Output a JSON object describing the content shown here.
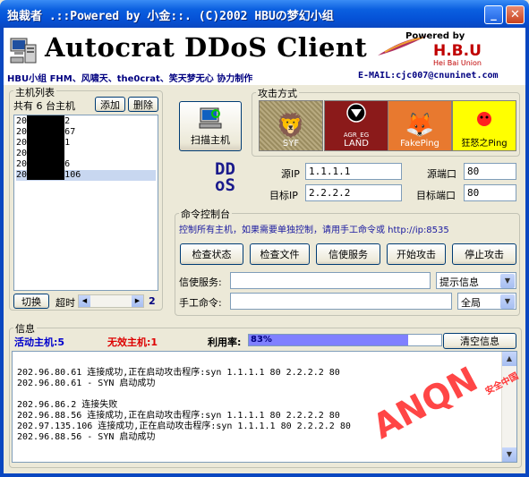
{
  "window": {
    "title": "独裁者 .::Powered by 小金::. (C)2002 HBUの梦幻小组",
    "minimize_label": "_",
    "close_label": "✕"
  },
  "banner": {
    "title": "Autocrat DDoS Client",
    "credits": "HBU小组 FHM、风啸天、the0crat、笑天梦无心 协力制作",
    "email": "E-MAIL:cjc007@cnuninet.com",
    "powered_by": "Powered by",
    "brand": "H.B.U",
    "brand_sub": "Hei Bai Union"
  },
  "host_panel": {
    "legend": "主机列表",
    "count_label": "共有 6 台主机",
    "add_label": "添加",
    "delete_label": "删除",
    "hosts": [
      "202.____42",
      "202.____.67",
      "202.____61",
      "202.____2",
      "202.____56",
      "202.____.106"
    ],
    "switch_label": "切换",
    "timeout_label": "超时",
    "timeout_value": "2"
  },
  "scan": {
    "label": "扫描主机"
  },
  "attack": {
    "legend": "攻击方式",
    "methods": [
      {
        "label": "SYF",
        "color": "#a89a70"
      },
      {
        "label": "LAND",
        "color": "#8b1a1a",
        "top_text": "AGR_EG"
      },
      {
        "label": "FakePing",
        "color": "#e8792f"
      },
      {
        "label": "狂怒之Ping",
        "color": "#ffff00"
      }
    ]
  },
  "ddos_logo": {
    "line1": "DD",
    "line2": "oS",
    "color": "#1a1a8c"
  },
  "target": {
    "src_ip_label": "源IP",
    "src_ip": "1.1.1.1",
    "src_port_label": "源端口",
    "src_port": "80",
    "dst_ip_label": "目标IP",
    "dst_ip": "2.2.2.2",
    "dst_port_label": "目标端口",
    "dst_port": "80"
  },
  "console": {
    "legend": "命令控制台",
    "hint": "控制所有主机，如果需要单独控制，请用手工命令或 http://ip:8535",
    "buttons": [
      "检查状态",
      "检查文件",
      "信使服务",
      "开始攻击",
      "停止攻击"
    ],
    "messenger_label": "信使服务:",
    "messenger_value": "",
    "messenger_option": "提示信息",
    "manual_label": "手工命令:",
    "manual_value": "",
    "manual_option": "全局"
  },
  "info": {
    "legend": "信息",
    "active_label": "活动主机:5",
    "invalid_label": "无效主机:1",
    "usage_label": "利用率:",
    "usage_value": "83%",
    "usage_fraction": 0.83,
    "clear_label": "清空信息",
    "log": [
      "202.96.80.61 连接成功,正在启动攻击程序:syn 1.1.1.1 80 2.2.2.2 80",
      "202.96.80.61 - SYN 启动成功",
      "",
      "202.96.86.2 连接失败",
      "202.96.88.56 连接成功,正在启动攻击程序:syn 1.1.1.1 80 2.2.2.2 80",
      "202.97.135.106 连接成功,正在启动攻击程序:syn 1.1.1.1 80 2.2.2.2 80",
      "202.96.88.56 - SYN 启动成功"
    ]
  },
  "watermark": {
    "text": "ANQN",
    "sub": "安全中国",
    "color": "#ff3333"
  }
}
